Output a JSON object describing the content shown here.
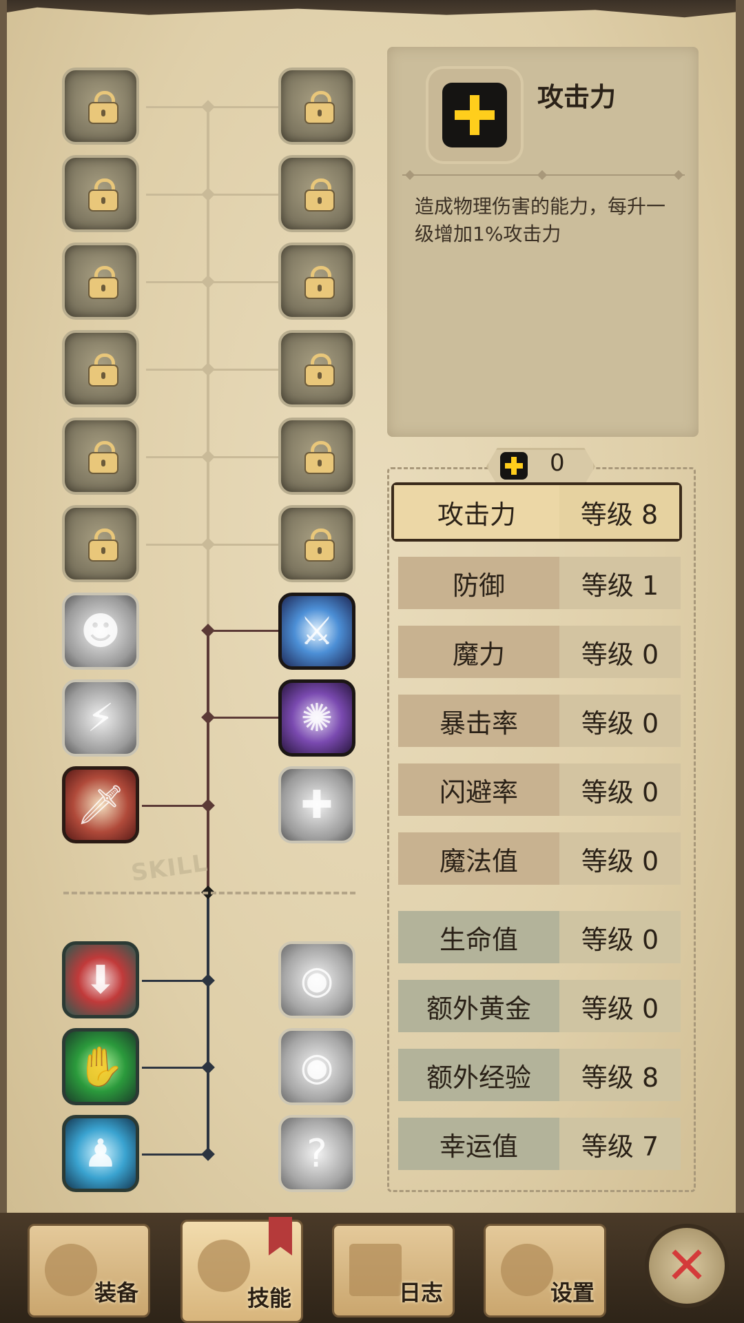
{
  "skill_tree": {
    "section_label": "SKILL"
  },
  "info": {
    "title": "攻击力",
    "description": "造成物理伤害的能力，每升一级增加1%攻击力"
  },
  "points": {
    "value": "0"
  },
  "stats": [
    {
      "name": "攻击力",
      "level": "等级 8",
      "selected": true
    },
    {
      "name": "防御",
      "level": "等级 1"
    },
    {
      "name": "魔力",
      "level": "等级 0"
    },
    {
      "name": "暴击率",
      "level": "等级 0"
    },
    {
      "name": "闪避率",
      "level": "等级 0"
    },
    {
      "name": "魔法值",
      "level": "等级 0"
    },
    {
      "name": "生命值",
      "level": "等级 0"
    },
    {
      "name": "额外黄金",
      "level": "等级 0"
    },
    {
      "name": "额外经验",
      "level": "等级 8"
    },
    {
      "name": "幸运值",
      "level": "等级 7"
    }
  ],
  "tabs": [
    {
      "label": "装备"
    },
    {
      "label": "技能",
      "active": true
    },
    {
      "label": "日志"
    },
    {
      "label": "设置"
    }
  ],
  "close": {
    "icon": "close-icon"
  },
  "colors": {
    "accent_yellow": "#ffce1c",
    "close_red": "#d43a3a",
    "tree_line_upper": "#5b3a36",
    "tree_line_lower": "#2c3440"
  }
}
